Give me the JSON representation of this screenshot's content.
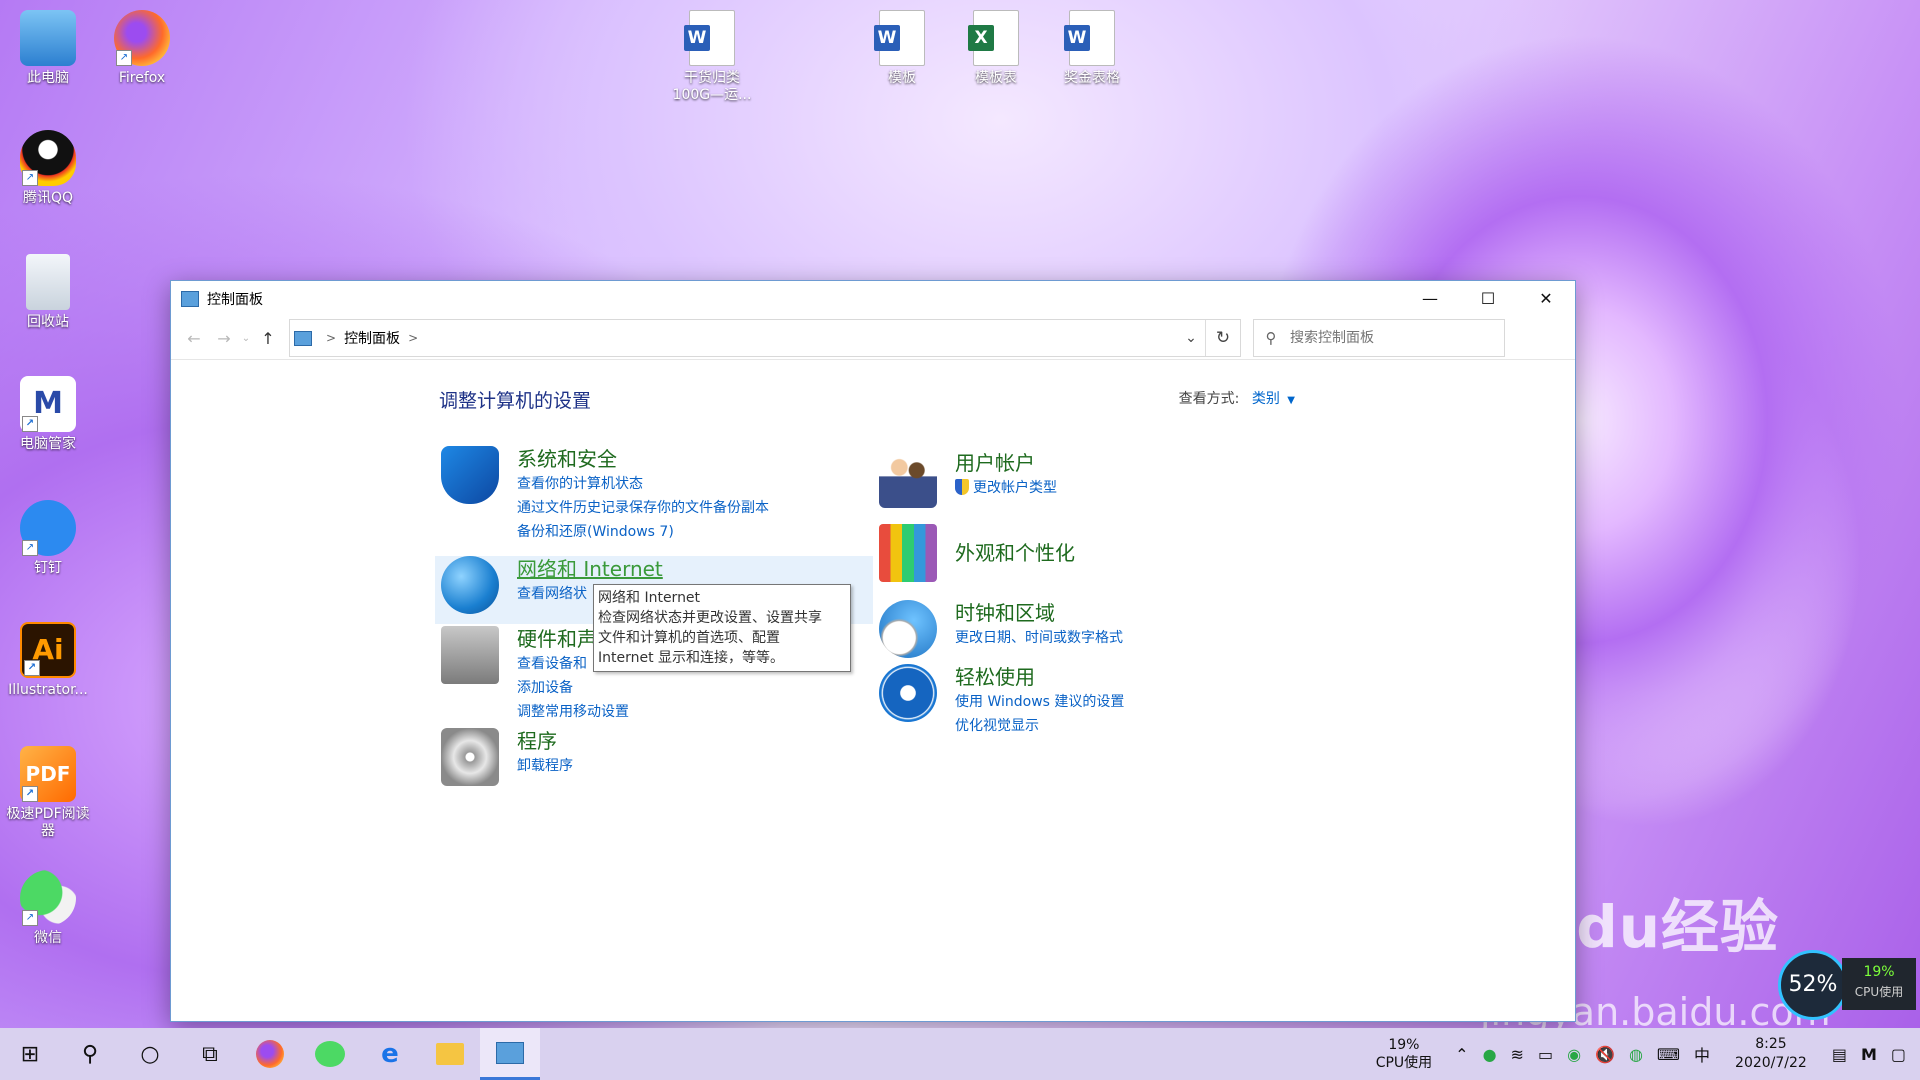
{
  "desktop": {
    "icons": [
      {
        "label": "此电脑"
      },
      {
        "label": "Firefox"
      },
      {
        "label": "腾讯QQ"
      },
      {
        "label": "回收站"
      },
      {
        "label": "电脑管家"
      },
      {
        "label": "钉钉"
      },
      {
        "label": "Illustrator..."
      },
      {
        "label": "极速PDF阅读器"
      },
      {
        "label": "微信"
      }
    ],
    "files": [
      {
        "label": "干货归类100G—运...",
        "badge": "W"
      },
      {
        "label": "模板",
        "badge": "W"
      },
      {
        "label": "模板表",
        "badge": "X"
      },
      {
        "label": "奖金表格",
        "badge": "W"
      }
    ]
  },
  "window": {
    "title": "控制面板",
    "address": {
      "crumb": "控制面板"
    },
    "search_placeholder": "搜索控制面板",
    "heading": "调整计算机的设置",
    "view_by_label": "查看方式:",
    "view_by_value": "类别",
    "categories_left": [
      {
        "title": "系统和安全",
        "links": [
          "查看你的计算机状态",
          "通过文件历史记录保存你的文件备份副本",
          "备份和还原(Windows 7)"
        ]
      },
      {
        "title": "网络和 Internet",
        "links": [
          "查看网络状"
        ]
      },
      {
        "title": "硬件和声",
        "links": [
          "查看设备和",
          "添加设备",
          "调整常用移动设置"
        ]
      },
      {
        "title": "程序",
        "links": [
          "卸载程序"
        ]
      }
    ],
    "categories_right": [
      {
        "title": "用户帐户",
        "links": [
          "更改帐户类型"
        ]
      },
      {
        "title": "外观和个性化",
        "links": []
      },
      {
        "title": "时钟和区域",
        "links": [
          "更改日期、时间或数字格式"
        ]
      },
      {
        "title": "轻松使用",
        "links": [
          "使用 Windows 建议的设置",
          "优化视觉显示"
        ]
      }
    ],
    "tooltip": {
      "line1": "网络和 Internet",
      "line2": "检查网络状态并更改设置、设置共享",
      "line3": "文件和计算机的首选项、配置",
      "line4": "Internet 显示和连接，等等。"
    }
  },
  "taskbar": {
    "cpu_percent": "19%",
    "cpu_label": "CPU使用",
    "time": "8:25",
    "date": "2020/7/22",
    "ime": "中"
  },
  "overlay": {
    "watermark": "Baidu经验",
    "watermark_url": "jingyan.baidu.com",
    "cpu_widget_value": "52%",
    "cpu_widget_percent": "19%",
    "cpu_widget_label": "CPU使用"
  }
}
